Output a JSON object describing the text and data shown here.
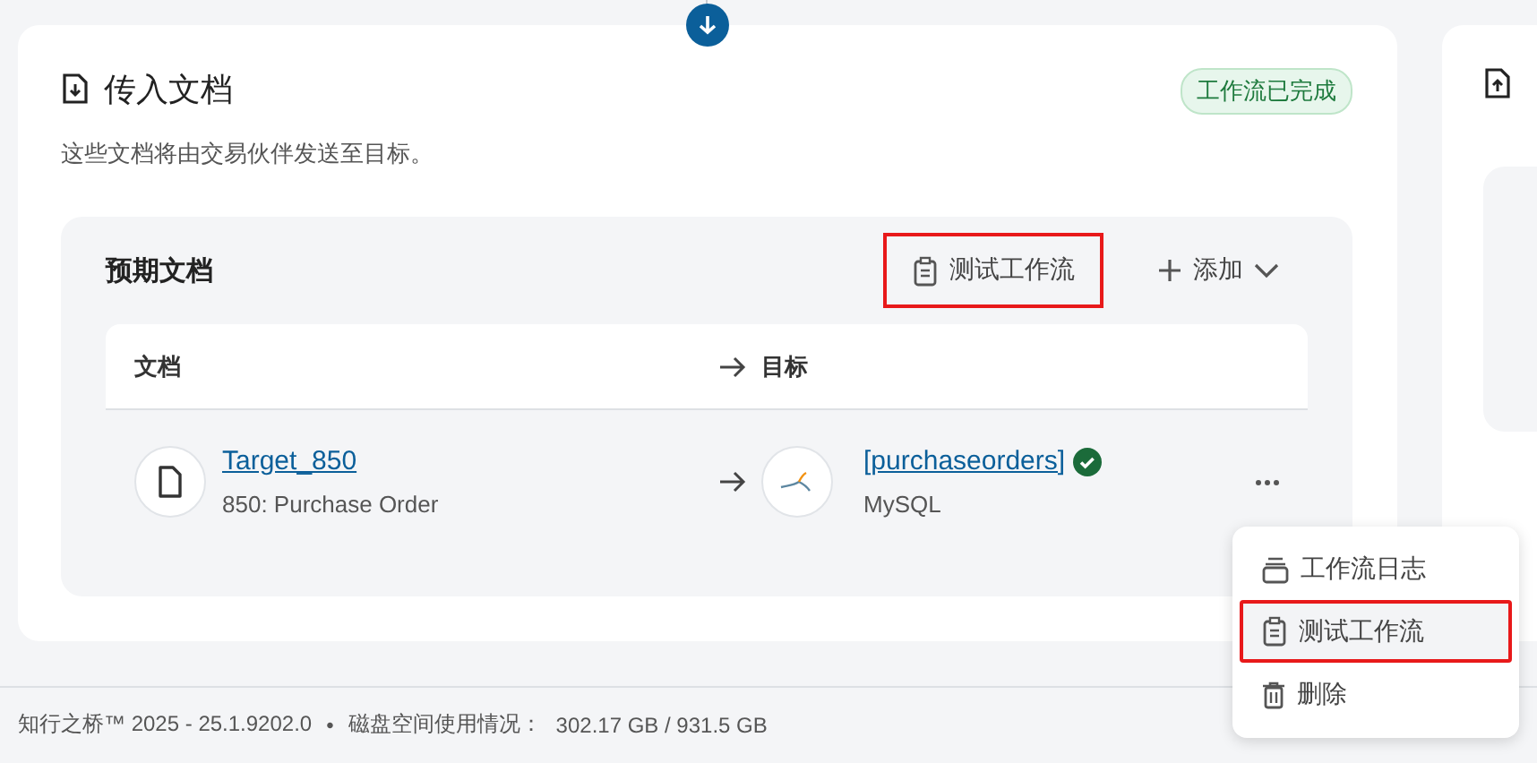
{
  "incoming_card": {
    "title": "传入文档",
    "status_badge": "工作流已完成",
    "description": "这些文档将由交易伙伴发送至目标。",
    "expected_panel": {
      "title": "预期文档",
      "actions": [
        {
          "kind": "test",
          "label": "测试工作流",
          "highlighted": true
        },
        {
          "kind": "add",
          "label": "添加",
          "highlighted": false
        }
      ],
      "columns": [
        "文档",
        "目标"
      ],
      "rows": [
        {
          "document": "Target_850",
          "document_type": "850: Purchase Order",
          "target": "[purchaseorders]",
          "target_type": "MySQL",
          "verified": true
        }
      ]
    }
  },
  "context_menu": {
    "items": [
      {
        "kind": "log",
        "label": "工作流日志",
        "hovered": false,
        "highlighted": false
      },
      {
        "kind": "test",
        "label": "测试工作流",
        "hovered": true,
        "highlighted": true
      },
      {
        "kind": "delete",
        "label": "删除",
        "hovered": false,
        "highlighted": false
      }
    ]
  },
  "footer": {
    "version": "知行之桥™ 2025 - 25.1.9202.0",
    "separator": "•",
    "disk_label": "磁盘空间使用情况：",
    "disk_value": "302.17 GB / 931.5 GB"
  }
}
